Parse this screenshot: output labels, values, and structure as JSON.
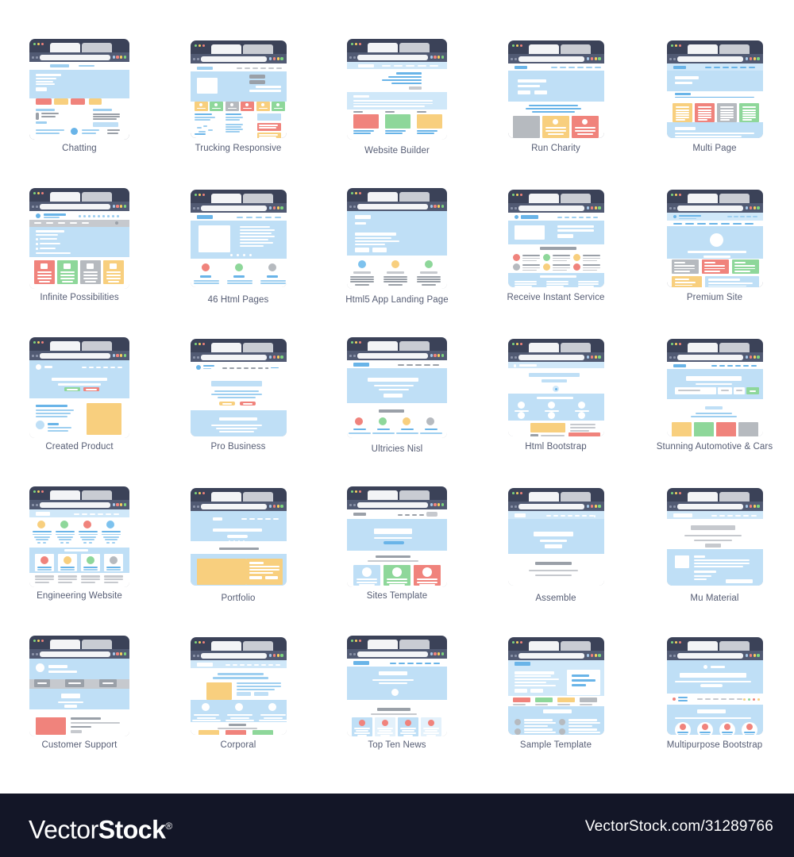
{
  "page": {
    "background": "#ffffff",
    "label_color": "#565d74",
    "frame_color": "#3b4258",
    "accent_blue": "#bfdff6",
    "columns": 5,
    "rows": 5,
    "total_items": 25
  },
  "items": [
    {
      "label": "Chatting",
      "label_pos": "normal"
    },
    {
      "label": "Trucking Responsive",
      "label_pos": "normal"
    },
    {
      "label": "Website Builder",
      "label_pos": "low"
    },
    {
      "label": "Run Charity",
      "label_pos": "normal"
    },
    {
      "label": "Multi Page",
      "label_pos": "normal"
    },
    {
      "label": "Infinite Possibilities",
      "label_pos": "normal"
    },
    {
      "label": "46 Html Pages",
      "label_pos": "low"
    },
    {
      "label": "Html5 App Landing Page",
      "label_pos": "low"
    },
    {
      "label": "Receive Instant Service",
      "label_pos": "normal"
    },
    {
      "label": "Premium Site",
      "label_pos": "normal"
    },
    {
      "label": "Created Product",
      "label_pos": "normal"
    },
    {
      "label": "Pro Business",
      "label_pos": "normal"
    },
    {
      "label": "Ultricies Nisl",
      "label_pos": "low"
    },
    {
      "label": "Html Bootstrap",
      "label_pos": "normal"
    },
    {
      "label": "Stunning Automotive & Cars",
      "label_pos": "normal"
    },
    {
      "label": "Engineering Website",
      "label_pos": "normal"
    },
    {
      "label": "Portfolio",
      "label_pos": "low"
    },
    {
      "label": "Sites Template",
      "label_pos": "normal"
    },
    {
      "label": "Assemble",
      "label_pos": "low"
    },
    {
      "label": "Mu Material",
      "label_pos": "low"
    },
    {
      "label": "Customer Support",
      "label_pos": "normal"
    },
    {
      "label": "Corporal",
      "label_pos": "normal"
    },
    {
      "label": "Top Ten News",
      "label_pos": "normal"
    },
    {
      "label": "Sample Template",
      "label_pos": "normal"
    },
    {
      "label": "Multipurpose Bootstrap",
      "label_pos": "normal"
    }
  ],
  "window_chrome": {
    "traffic_lights_left": [
      "#7ed67e",
      "#f8cf5e",
      "#f0837c"
    ],
    "traffic_lights_right": [
      "#a8c8e8",
      "#f0837c",
      "#f8cf5e",
      "#7ed67e"
    ],
    "tab_active_color": "#f3f4f6",
    "tab_inactive_color": "#c9ccd3",
    "urlbar_color": "#515a73",
    "urlfield_color": "#f4f5f7"
  },
  "palette": {
    "red": "#f0837c",
    "green": "#8ed79a",
    "yellow": "#f8cf7e",
    "grey": "#b6babf",
    "blue": "#7dc2ee",
    "light_blue": "#bfdff6",
    "pale_blue": "#d0e8f9"
  },
  "footer": {
    "brand_light": "Vector",
    "brand_bold": "Stock",
    "registered": "®",
    "url": "VectorStock.com/31289766",
    "background": "#131627"
  }
}
